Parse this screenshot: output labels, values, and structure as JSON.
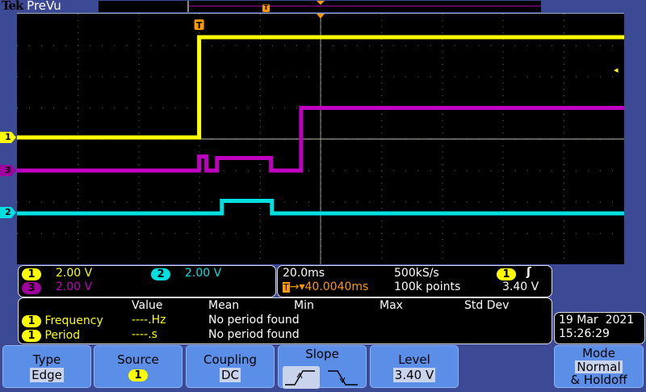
{
  "header": {
    "brand": "Tek",
    "mode": "PreVu"
  },
  "channels": {
    "ch1": {
      "label": "1",
      "scale": "2.00 V",
      "color": "#ffff00"
    },
    "ch2": {
      "label": "2",
      "scale": "2.00 V",
      "color": "#00e0e0"
    },
    "ch3": {
      "label": "3",
      "scale": "2.00 V",
      "color": "#c000c0"
    }
  },
  "timebase": {
    "scale": "20.0ms",
    "sample_rate": "500kS/s",
    "trigger_position": "40.0040ms",
    "record_length": "100k points",
    "trigger_source": "1",
    "trigger_level": "3.40 V",
    "trigger_icon": "T"
  },
  "measurements": {
    "headers": [
      "Value",
      "Mean",
      "Min",
      "Max",
      "Std Dev"
    ],
    "rows": [
      {
        "source": "1",
        "name": "Frequency",
        "value": "----.Hz",
        "mean": "No period found"
      },
      {
        "source": "1",
        "name": "Period",
        "value": "----.s",
        "mean": "No period found"
      }
    ]
  },
  "datetime": {
    "date": "19 Mar  2021",
    "time": "15:26:29"
  },
  "menu": {
    "type": {
      "label": "Type",
      "value": "Edge"
    },
    "source": {
      "label": "Source",
      "value": "1"
    },
    "coupling": {
      "label": "Coupling",
      "value": "DC"
    },
    "slope": {
      "label": "Slope"
    },
    "level": {
      "label": "Level",
      "value": "3.40 V"
    },
    "mode": {
      "label": "Mode",
      "value": "Normal",
      "extra": "& Holdoff"
    }
  },
  "traces": {
    "time_per_div_ms": 20,
    "volts_per_div": 2,
    "trigger_offset_div": -2,
    "ch1": [
      [
        -60,
        0
      ],
      [
        0,
        0
      ],
      [
        0,
        6.4
      ],
      [
        140,
        6.4
      ]
    ],
    "ch3": [
      [
        -60,
        0
      ],
      [
        0,
        0
      ],
      [
        0,
        0.9
      ],
      [
        2.4,
        0.9
      ],
      [
        2.4,
        0
      ],
      [
        5.9,
        0
      ],
      [
        5.9,
        0.8
      ],
      [
        23.7,
        0.8
      ],
      [
        23.7,
        0
      ],
      [
        33.6,
        0
      ],
      [
        33.6,
        4
      ],
      [
        140,
        4
      ]
    ],
    "ch2": [
      [
        -60,
        0
      ],
      [
        7.5,
        0
      ],
      [
        7.5,
        0.8
      ],
      [
        24,
        0.8
      ],
      [
        24,
        0
      ],
      [
        140,
        0
      ]
    ]
  }
}
